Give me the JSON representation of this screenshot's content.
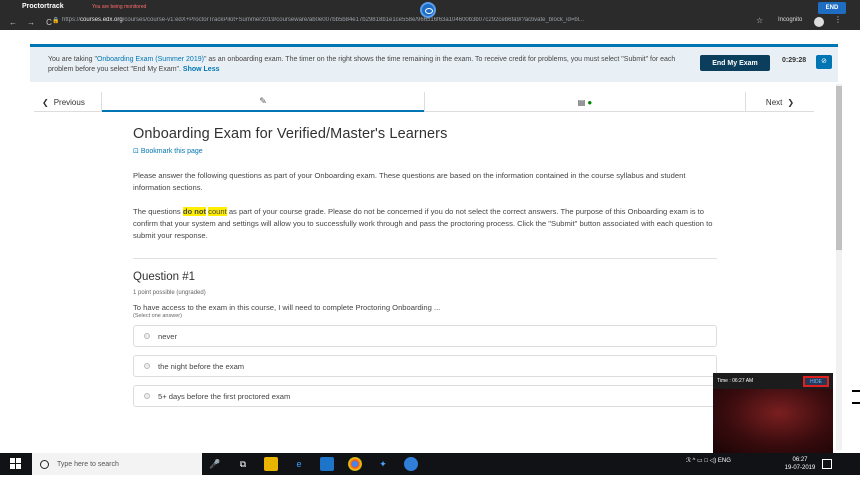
{
  "proctor_bar": {
    "app_label": "Proctortrack",
    "monitor_text": "You are being monitored",
    "end_label": "END"
  },
  "browser": {
    "url_scheme": "https://",
    "url_host": "courses.edx.org",
    "url_path": "/courses/course-v1:edX+ProctorTrackPilot+Summer2019/courseware/ab0e007bb5b84e17b29818b1e1ce558e/966516f63a104600b3b07c292ceb6fa9/?activate_block_id=bl...",
    "incognito_label": "Incognito"
  },
  "banner": {
    "msg_prefix": "You are taking \"",
    "exam_link": "Onboarding Exam (Summer 2019)",
    "msg_suffix": "\" as an onboarding exam. The timer on the right shows the time remaining in the exam. To receive credit for problems, you must select \"Submit\" for each problem before you select \"End My Exam\". ",
    "show_less": "Show Less",
    "end_exam_label": "End My Exam",
    "timer": "0:29:28"
  },
  "seqnav": {
    "previous_label": "Previous",
    "next_label": "Next"
  },
  "content": {
    "title": "Onboarding Exam for Verified/Master's Learners",
    "bookmark": "Bookmark this page",
    "para1": "Please answer the following questions as part of your Onboarding exam. These questions are based on the information contained in the course syllabus and student information sections.",
    "para2_a": "The questions ",
    "para2_hl1": "do not",
    "para2_hl2": "count",
    "para2_b": " as part of your course grade. Please do not be concerned if you do not select the correct answers. The purpose of this Onboarding exam is to confirm that your system and settings will allow you to successfully work through and pass the proctoring process. Click the \"Submit\" button associated with each question to submit your response."
  },
  "question": {
    "title": "Question #1",
    "points": "1 point possible (ungraded)",
    "text": "To have access to the exam in this course, I will need to complete Proctoring Onboarding ...",
    "sub": "(Select one answer)",
    "options": [
      "never",
      "the night before the exam",
      "5+ days before the first proctored exam"
    ]
  },
  "webcam": {
    "time_label": "Time : 06:27 AM",
    "hide_label": "HIDE"
  },
  "taskbar": {
    "search_placeholder": "Type here to search",
    "tray_lang": "ENG",
    "clock_time": "06:27",
    "clock_date": "19-07-2019"
  }
}
